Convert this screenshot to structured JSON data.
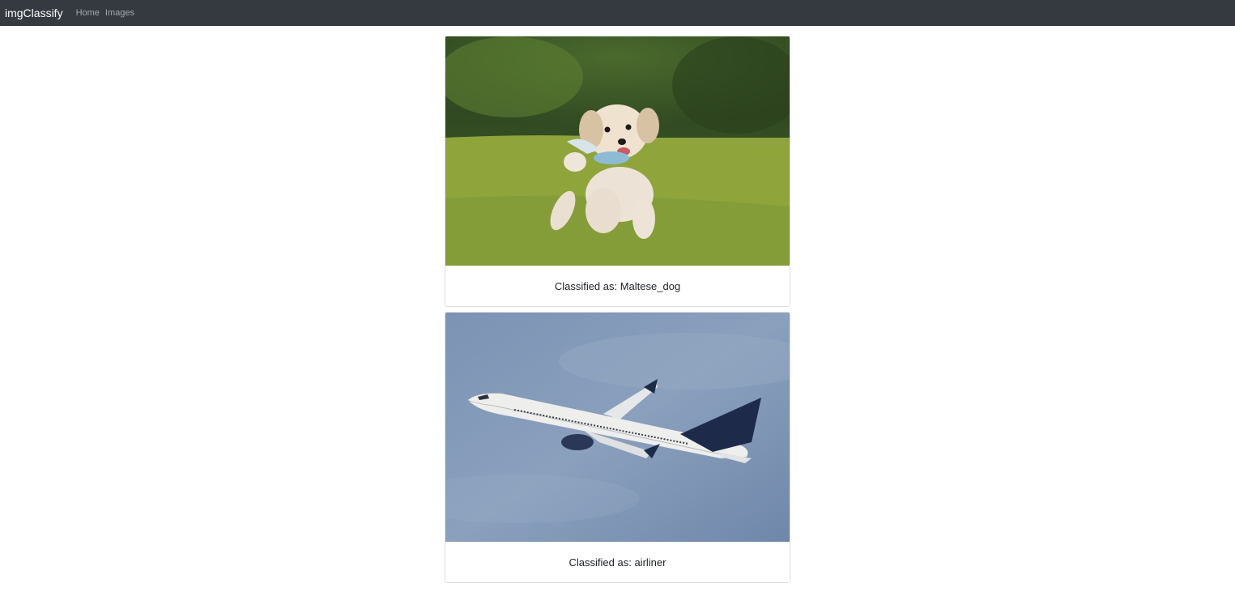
{
  "navbar": {
    "brand": "imgClassify",
    "links": [
      "Home",
      "Images"
    ]
  },
  "cards": [
    {
      "image_subject": "dog",
      "caption": "Classified as: Maltese_dog"
    },
    {
      "image_subject": "airplane",
      "caption": "Classified as: airliner"
    }
  ],
  "colors": {
    "navbar_bg": "#343a40",
    "brand": "#ffffff",
    "nav_link": "#9a9da0",
    "card_border": "#dcdfe2"
  }
}
